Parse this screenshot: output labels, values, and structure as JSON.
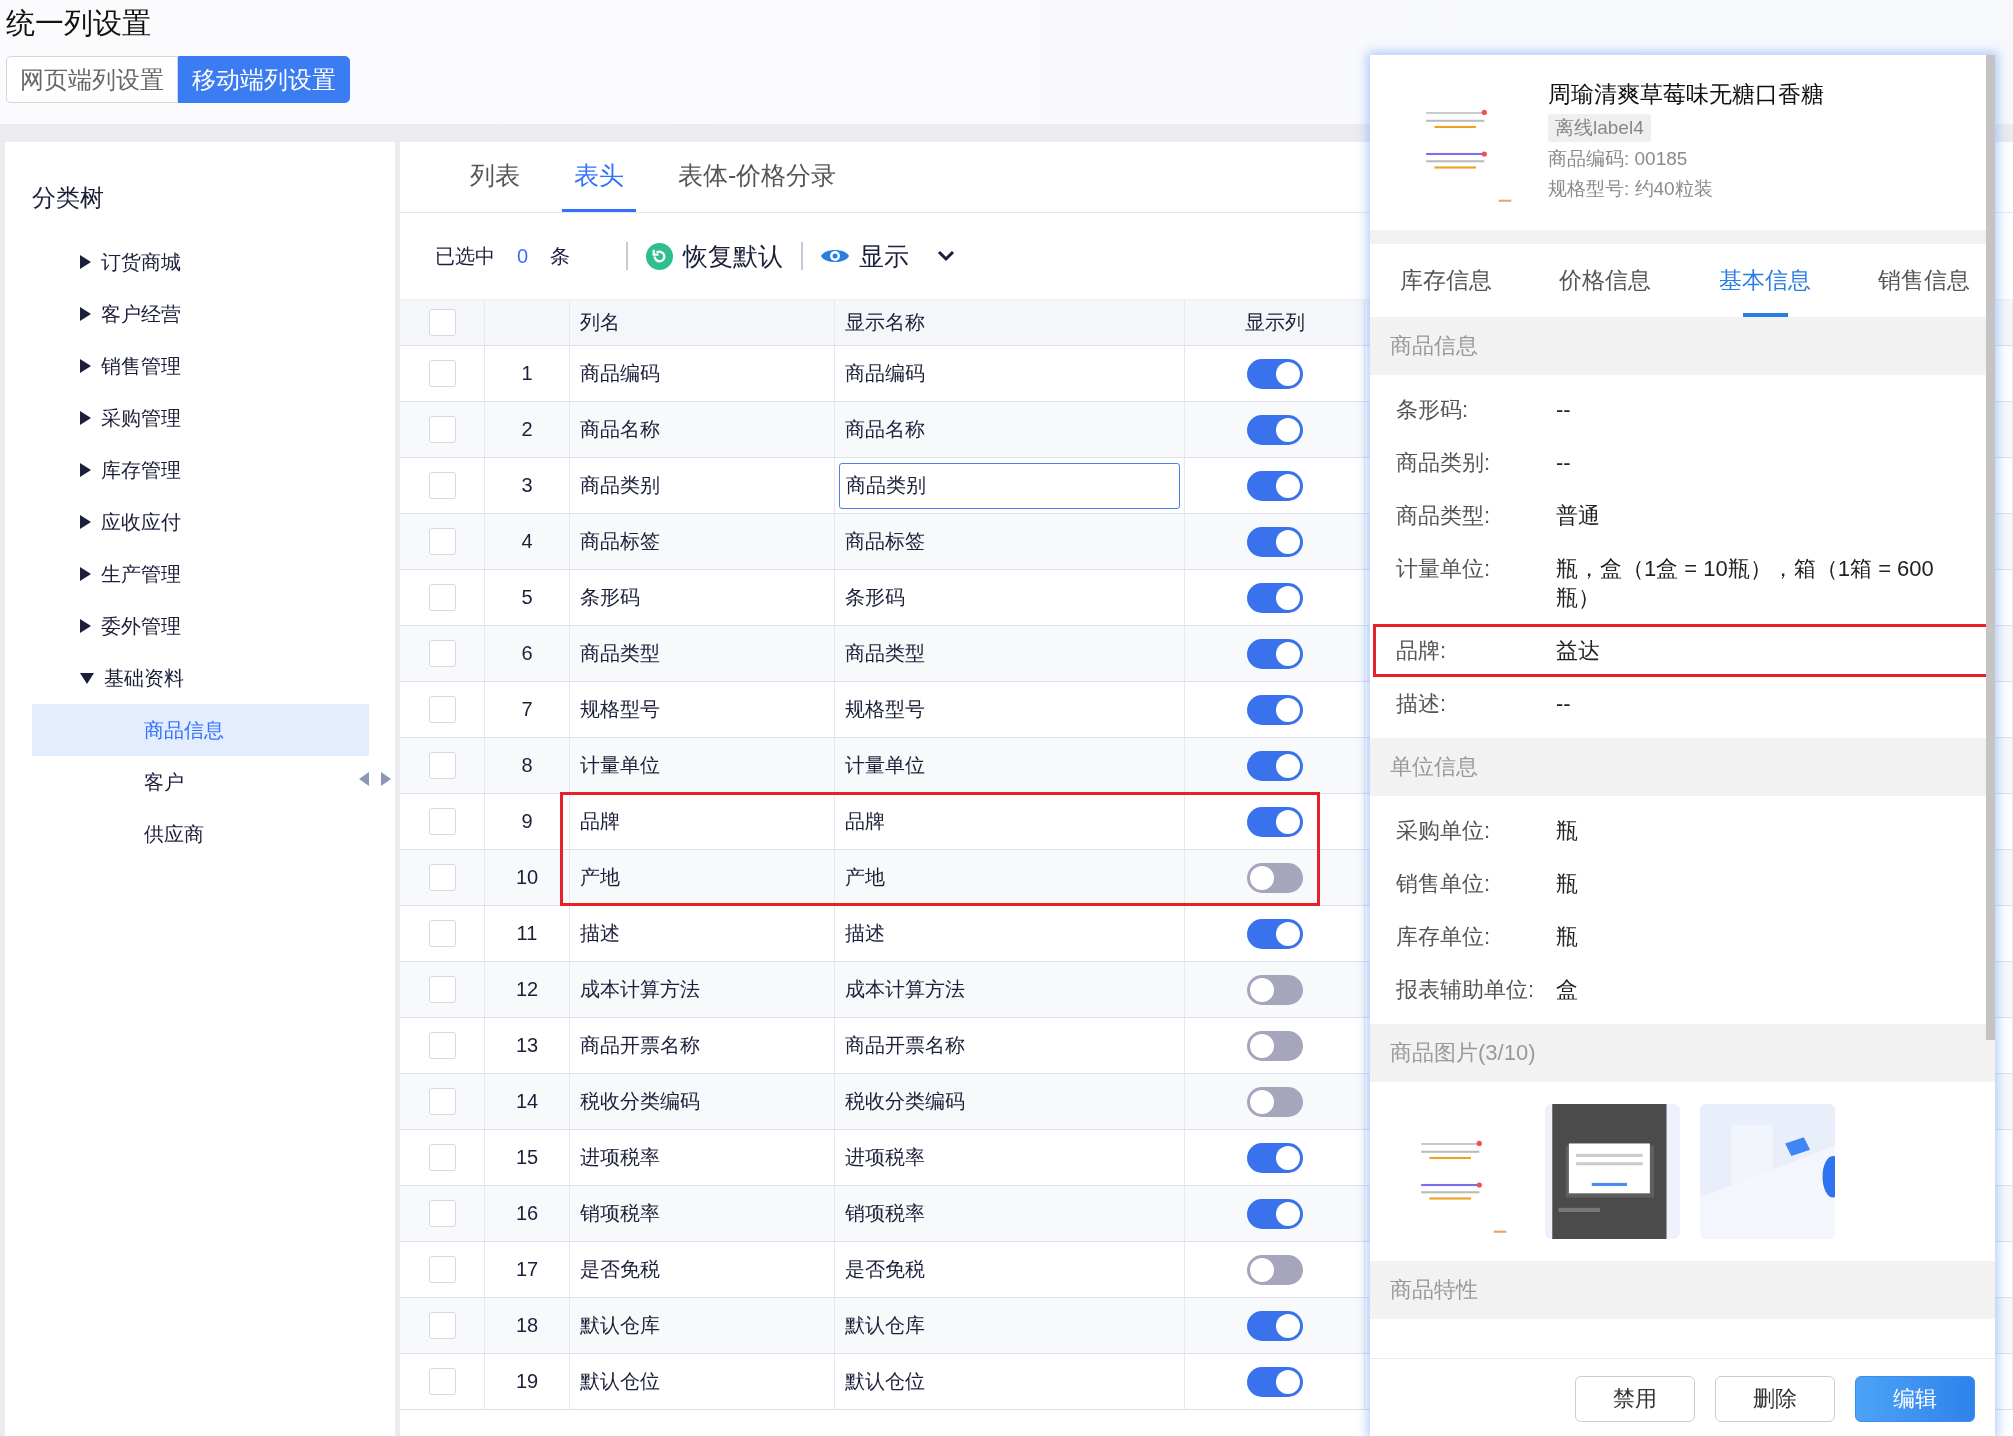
{
  "page_title": "统一列设置",
  "mode_tabs": [
    {
      "label": "网页端列设置",
      "selected": false
    },
    {
      "label": "移动端列设置",
      "selected": true
    }
  ],
  "sidebar": {
    "title": "分类树",
    "items": [
      {
        "label": "订货商城",
        "expanded": false
      },
      {
        "label": "客户经营",
        "expanded": false
      },
      {
        "label": "销售管理",
        "expanded": false
      },
      {
        "label": "采购管理",
        "expanded": false
      },
      {
        "label": "库存管理",
        "expanded": false
      },
      {
        "label": "应收应付",
        "expanded": false
      },
      {
        "label": "生产管理",
        "expanded": false
      },
      {
        "label": "委外管理",
        "expanded": false
      },
      {
        "label": "基础资料",
        "expanded": true,
        "children": [
          {
            "label": "商品信息",
            "selected": true
          },
          {
            "label": "客户",
            "selected": false
          },
          {
            "label": "供应商",
            "selected": false
          }
        ]
      }
    ]
  },
  "sub_tabs": [
    {
      "label": "列表",
      "selected": false
    },
    {
      "label": "表头",
      "selected": true
    },
    {
      "label": "表体-价格分录",
      "selected": false
    }
  ],
  "toolbar": {
    "selected_prefix": "已选中",
    "selected_count": "0",
    "selected_suffix": "条",
    "reset_button": "恢复默认",
    "show_button": "显示"
  },
  "table": {
    "header_checked": false,
    "columns": [
      "列名",
      "显示名称",
      "显示列"
    ],
    "rows": [
      {
        "index": "1",
        "column_name": "商品编码",
        "display_name": "商品编码",
        "checked": false,
        "visible": true,
        "editing": false,
        "highlighted": false
      },
      {
        "index": "2",
        "column_name": "商品名称",
        "display_name": "商品名称",
        "checked": false,
        "visible": true,
        "editing": false,
        "highlighted": false
      },
      {
        "index": "3",
        "column_name": "商品类别",
        "display_name": "商品类别",
        "checked": false,
        "visible": true,
        "editing": true,
        "highlighted": false
      },
      {
        "index": "4",
        "column_name": "商品标签",
        "display_name": "商品标签",
        "checked": false,
        "visible": true,
        "editing": false,
        "highlighted": false
      },
      {
        "index": "5",
        "column_name": "条形码",
        "display_name": "条形码",
        "checked": false,
        "visible": true,
        "editing": false,
        "highlighted": false
      },
      {
        "index": "6",
        "column_name": "商品类型",
        "display_name": "商品类型",
        "checked": false,
        "visible": true,
        "editing": false,
        "highlighted": false
      },
      {
        "index": "7",
        "column_name": "规格型号",
        "display_name": "规格型号",
        "checked": false,
        "visible": true,
        "editing": false,
        "highlighted": false
      },
      {
        "index": "8",
        "column_name": "计量单位",
        "display_name": "计量单位",
        "checked": false,
        "visible": true,
        "editing": false,
        "highlighted": false
      },
      {
        "index": "9",
        "column_name": "品牌",
        "display_name": "品牌",
        "checked": false,
        "visible": true,
        "editing": false,
        "highlighted": true
      },
      {
        "index": "10",
        "column_name": "产地",
        "display_name": "产地",
        "checked": false,
        "visible": false,
        "editing": false,
        "highlighted": true
      },
      {
        "index": "11",
        "column_name": "描述",
        "display_name": "描述",
        "checked": false,
        "visible": true,
        "editing": false,
        "highlighted": false
      },
      {
        "index": "12",
        "column_name": "成本计算方法",
        "display_name": "成本计算方法",
        "checked": false,
        "visible": false,
        "editing": false,
        "highlighted": false
      },
      {
        "index": "13",
        "column_name": "商品开票名称",
        "display_name": "商品开票名称",
        "checked": false,
        "visible": false,
        "editing": false,
        "highlighted": false
      },
      {
        "index": "14",
        "column_name": "税收分类编码",
        "display_name": "税收分类编码",
        "checked": false,
        "visible": false,
        "editing": false,
        "highlighted": false
      },
      {
        "index": "15",
        "column_name": "进项税率",
        "display_name": "进项税率",
        "checked": false,
        "visible": true,
        "editing": false,
        "highlighted": false
      },
      {
        "index": "16",
        "column_name": "销项税率",
        "display_name": "销项税率",
        "checked": false,
        "visible": true,
        "editing": false,
        "highlighted": false
      },
      {
        "index": "17",
        "column_name": "是否免税",
        "display_name": "是否免税",
        "checked": false,
        "visible": false,
        "editing": false,
        "highlighted": false
      },
      {
        "index": "18",
        "column_name": "默认仓库",
        "display_name": "默认仓库",
        "checked": false,
        "visible": true,
        "editing": false,
        "highlighted": false
      },
      {
        "index": "19",
        "column_name": "默认仓位",
        "display_name": "默认仓位",
        "checked": false,
        "visible": true,
        "editing": false,
        "highlighted": false
      }
    ]
  },
  "detail_panel": {
    "title": "周瑜清爽草莓味无糖口香糖",
    "tag": "离线label4",
    "code": "商品编码: 00185",
    "spec": "规格型号: 约40粒装",
    "tabs": [
      {
        "label": "库存信息",
        "selected": false
      },
      {
        "label": "价格信息",
        "selected": false
      },
      {
        "label": "基本信息",
        "selected": true
      },
      {
        "label": "销售信息",
        "selected": false
      }
    ],
    "sections": [
      {
        "kind": "fields",
        "title": "商品信息",
        "fields": [
          {
            "label": "条形码:",
            "value": "--",
            "highlighted": false
          },
          {
            "label": "商品类别:",
            "value": "--",
            "highlighted": false
          },
          {
            "label": "商品类型:",
            "value": "普通",
            "highlighted": false
          },
          {
            "label": "计量单位:",
            "value": "瓶，盒（1盒 = 10瓶），箱（1箱 = 600瓶）",
            "highlighted": false
          },
          {
            "label": "品牌:",
            "value": "益达",
            "highlighted": true
          },
          {
            "label": "描述:",
            "value": "--",
            "highlighted": false
          }
        ]
      },
      {
        "kind": "fields",
        "title": "单位信息",
        "fields": [
          {
            "label": "采购单位:",
            "value": "瓶",
            "highlighted": false
          },
          {
            "label": "销售单位:",
            "value": "瓶",
            "highlighted": false
          },
          {
            "label": "库存单位:",
            "value": "瓶",
            "highlighted": false
          },
          {
            "label": "报表辅助单位:",
            "value": "盒",
            "highlighted": false
          }
        ]
      },
      {
        "kind": "images",
        "title": "商品图片(3/10)"
      },
      {
        "kind": "empty",
        "title": "商品特性"
      }
    ],
    "buttons": [
      {
        "label": "禁用",
        "primary": false
      },
      {
        "label": "删除",
        "primary": false
      },
      {
        "label": "编辑",
        "primary": true
      }
    ]
  }
}
